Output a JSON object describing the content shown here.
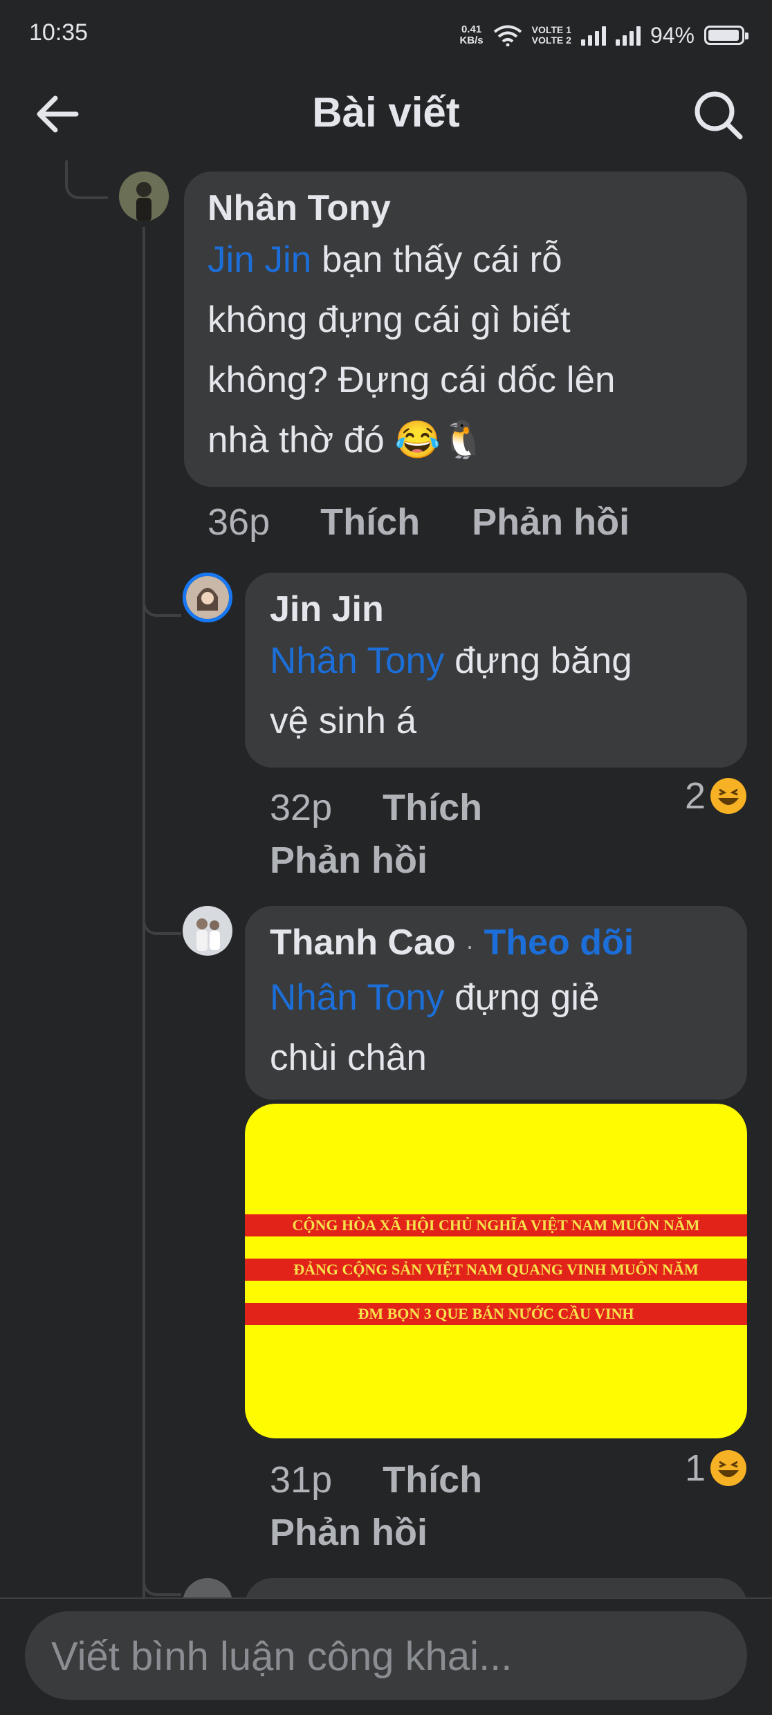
{
  "status_bar": {
    "time": "10:35",
    "net_speed": "0.41",
    "net_unit": "KB/s",
    "volte1": "VOLTE 1",
    "volte2": "VOLTE 2",
    "battery": "94%"
  },
  "header": {
    "title": "Bài viết",
    "back_icon": "arrow-left-icon",
    "search_icon": "search-icon"
  },
  "comments": [
    {
      "author": "Nhân Tony",
      "mention": "Jin Jin",
      "text_line1": " bạn thấy cái rỗ",
      "text_line2": "không đựng cái gì biết",
      "text_line3": "không? Đựng cái dốc lên",
      "text_line4": "nhà thờ đó 😂🐧",
      "time": "36p",
      "like": "Thích",
      "reply": "Phản hồi"
    },
    {
      "author": "Jin Jin",
      "mention": "Nhân Tony",
      "text_line1": " đựng băng",
      "text_line2": "vệ sinh á",
      "time": "32p",
      "like": "Thích",
      "reply": "Phản hồi",
      "reaction_count": "2"
    },
    {
      "author": "Thanh Cao",
      "separator": "·",
      "follow": "Theo dõi",
      "mention": "Nhân Tony",
      "text_line1": " đựng giẻ",
      "text_line2": "chùi chân",
      "image_text": [
        "CỘNG HÒA XÃ HỘI CHỦ NGHĨA VIỆT NAM MUÔN NĂM",
        "ĐẢNG CỘNG SẢN VIỆT NAM QUANG VINH MUÔN NĂM",
        "ĐM BỌN 3 QUE BÁN NƯỚC CẦU VINH"
      ],
      "time": "31p",
      "like": "Thích",
      "reply": "Phản hồi",
      "reaction_count": "1"
    }
  ],
  "composer": {
    "placeholder": "Viết bình luận công khai..."
  },
  "colors": {
    "background": "#242526",
    "bubble": "#3a3b3c",
    "mention": "#1c6ed8",
    "image_yellow": "#fffb00",
    "image_red": "#e2231a"
  }
}
